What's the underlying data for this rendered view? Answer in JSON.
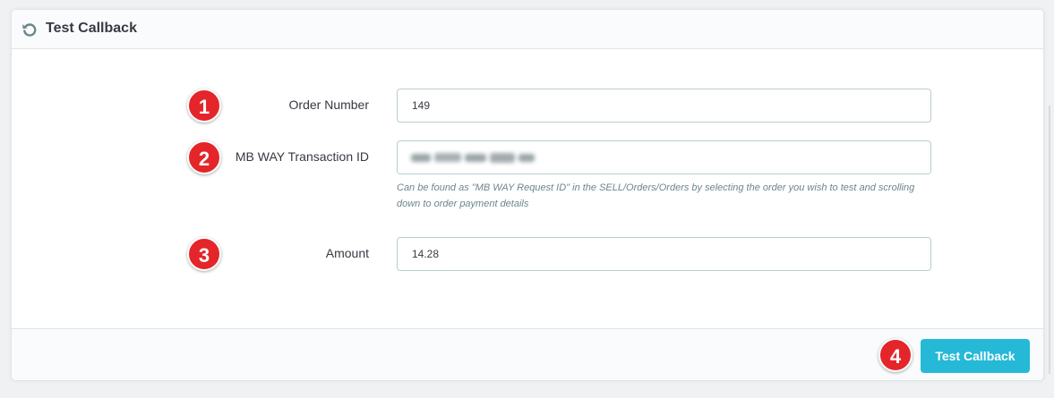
{
  "panel": {
    "title": "Test Callback",
    "icon": "refresh-icon"
  },
  "fields": [
    {
      "badge": "1",
      "label": "Order Number",
      "value": "149"
    },
    {
      "badge": "2",
      "label": "MB WAY Transaction ID",
      "value": "",
      "help": "Can be found as \"MB WAY Request ID\" in the SELL/Orders/Orders by selecting the order you wish to test and scrolling down to order payment details"
    },
    {
      "badge": "3",
      "label": "Amount",
      "value": "14.28"
    }
  ],
  "footer": {
    "badge": "4",
    "submit_label": "Test Callback"
  },
  "colors": {
    "accent": "#25b9d7",
    "badge": "#e4262a",
    "text": "#363a41",
    "help_text": "#6c868e",
    "border": "#bbcdd2"
  }
}
